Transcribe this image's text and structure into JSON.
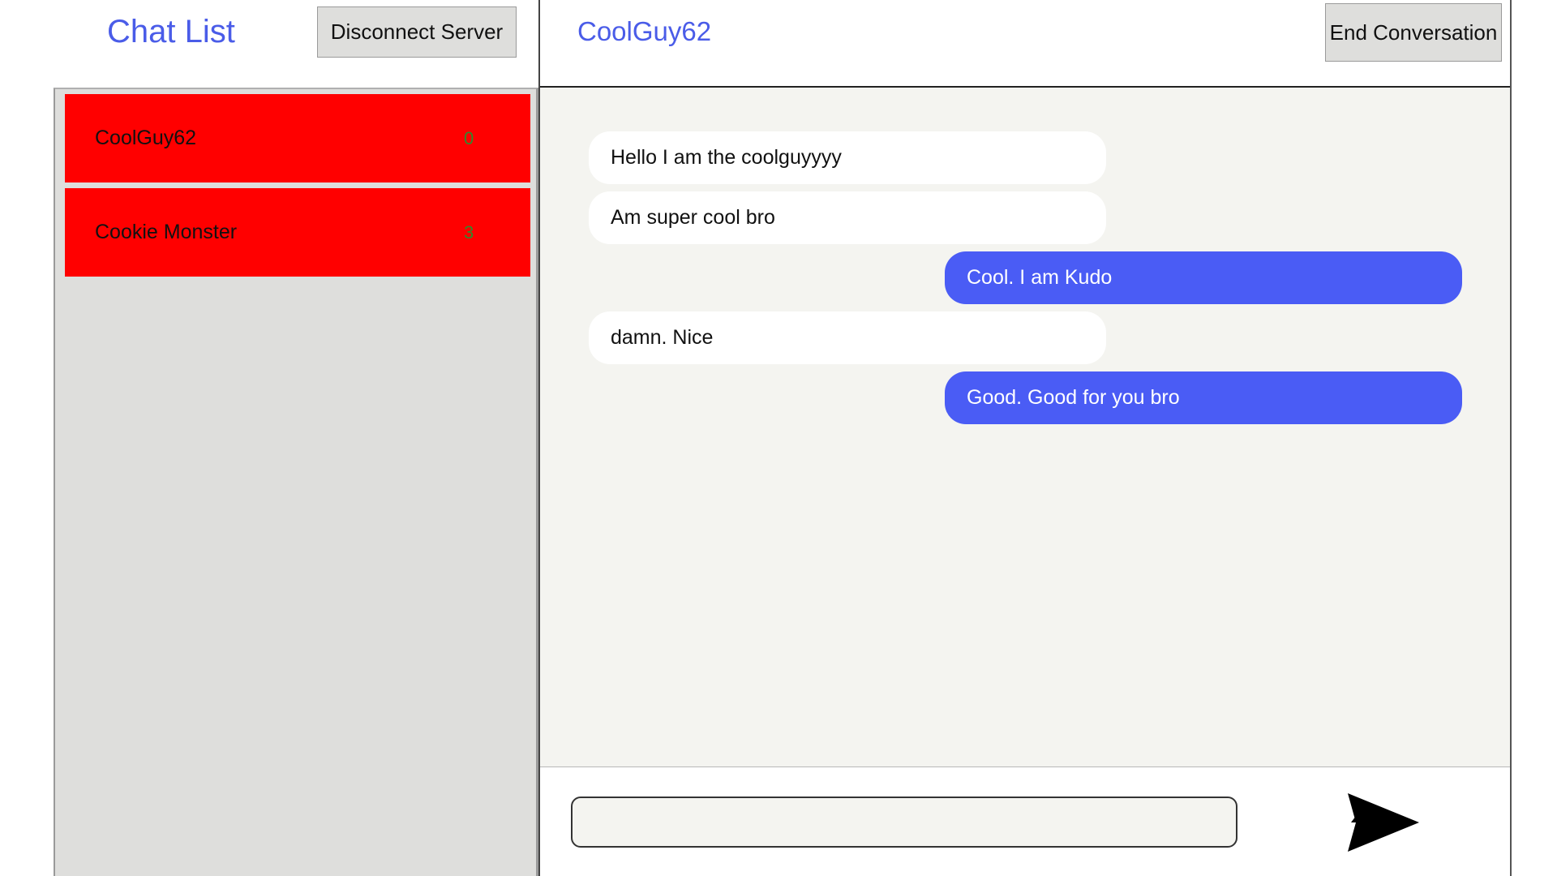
{
  "chat_list": {
    "title": "Chat List",
    "disconnect_label": "Disconnect Server",
    "items": [
      {
        "name": "CoolGuy62",
        "count": "0"
      },
      {
        "name": "Cookie Monster",
        "count": "3"
      }
    ]
  },
  "conversation": {
    "title": "CoolGuy62",
    "end_label": "End Conversation",
    "messages": [
      {
        "direction": "incoming",
        "text": "Hello I am the coolguyyyy"
      },
      {
        "direction": "incoming",
        "text": "Am super cool bro"
      },
      {
        "direction": "outgoing",
        "text": "Cool. I am Kudo"
      },
      {
        "direction": "incoming",
        "text": "damn. Nice"
      },
      {
        "direction": "outgoing",
        "text": "Good. Good for you bro"
      }
    ],
    "input": {
      "value": "",
      "placeholder": ""
    },
    "send_icon": "send-arrow-icon"
  },
  "colors": {
    "accent": "#4a5ce8",
    "chat_item_bg": "#ff0000",
    "unread_count": "#2e8b2e",
    "outgoing_bubble": "#4a5cf5",
    "incoming_bubble": "#ffffff",
    "list_bg": "#dededc",
    "messages_bg": "#f4f4f0"
  }
}
